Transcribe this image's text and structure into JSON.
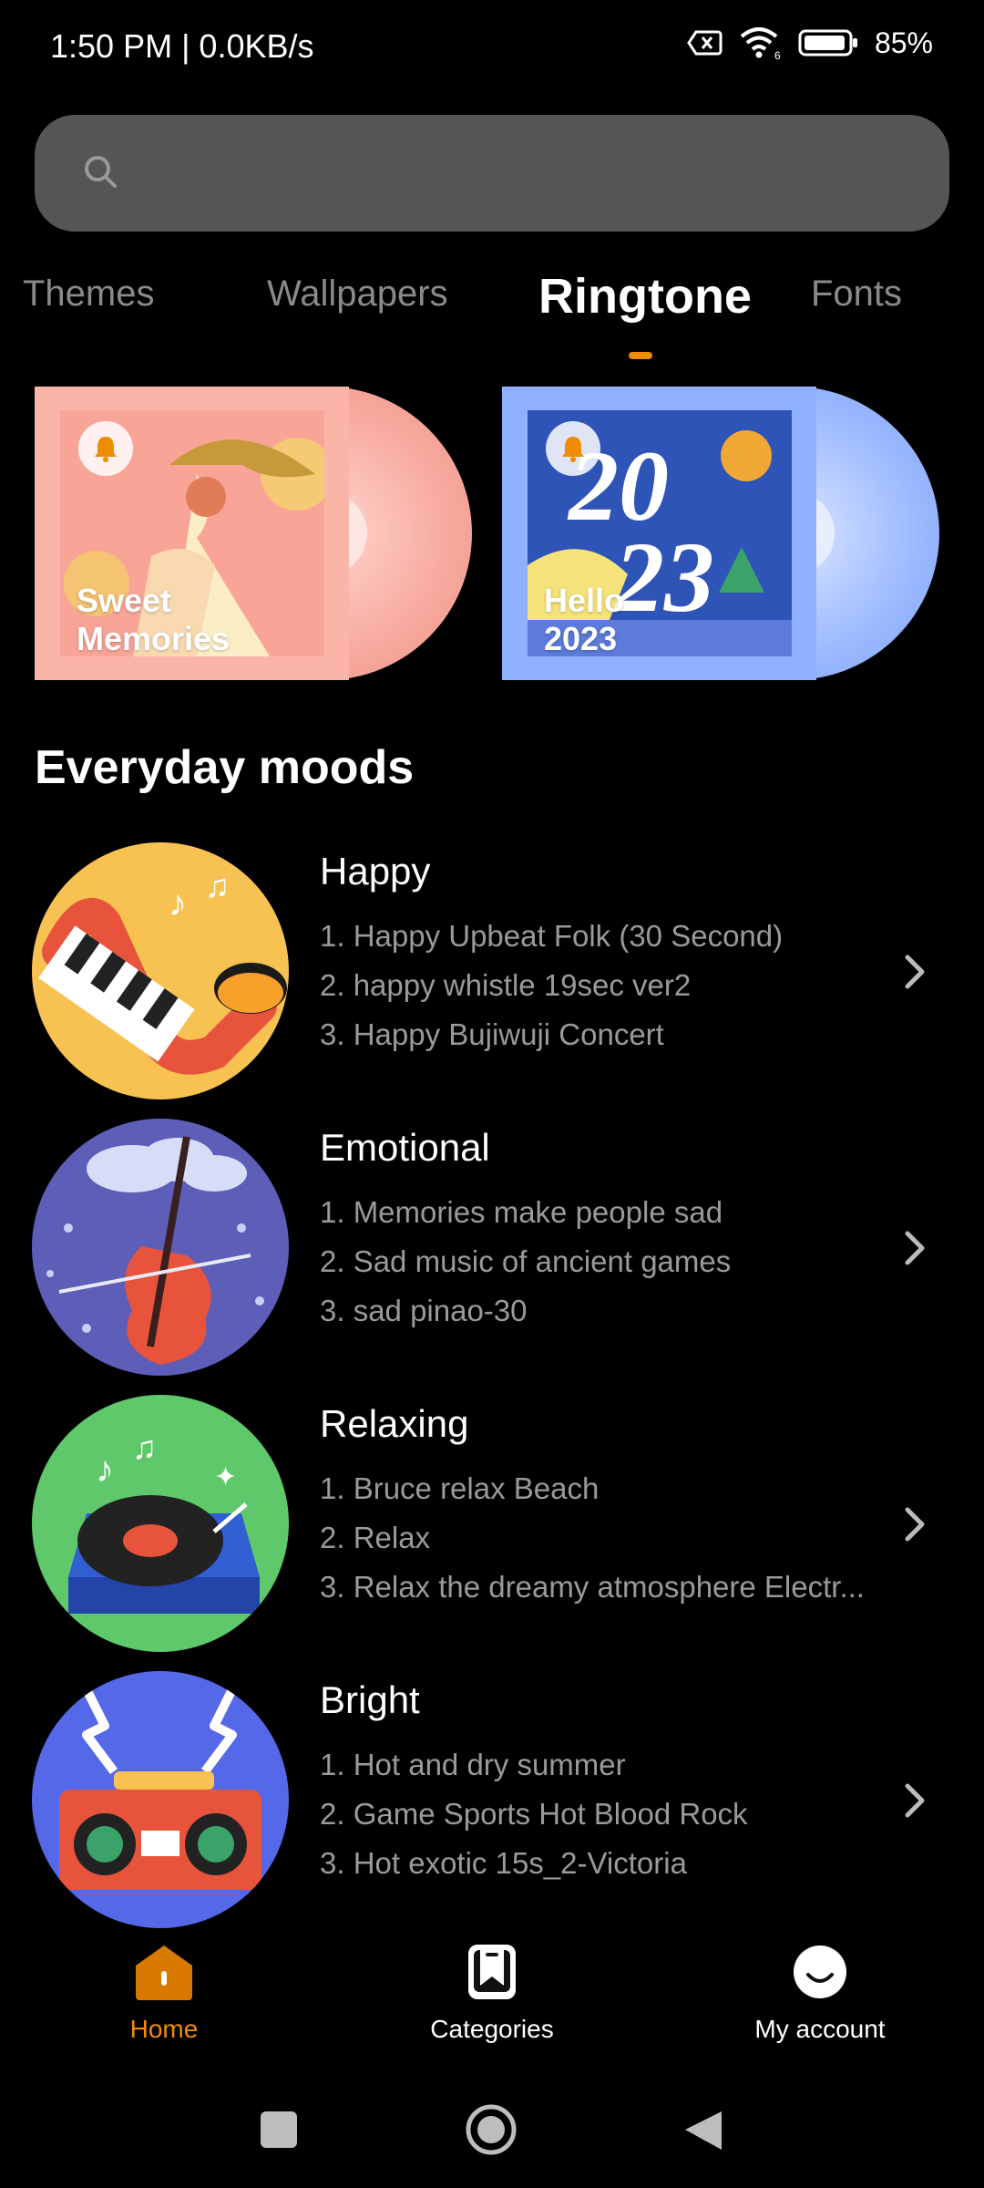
{
  "status": {
    "time": "1:50 PM | 0.0KB/s",
    "battery": "85%"
  },
  "search": {
    "placeholder": ""
  },
  "tabs": [
    {
      "label": "Themes",
      "active": false
    },
    {
      "label": "Wallpapers",
      "active": false
    },
    {
      "label": "Ringtone",
      "active": true
    },
    {
      "label": "Fonts",
      "active": false
    }
  ],
  "featured": [
    {
      "title_line1": "Sweet",
      "title_line2": "Memories",
      "accent": "#f7a99e"
    },
    {
      "title_line1": "Hello",
      "title_line2": "2023",
      "accent": "#8fb0ff"
    }
  ],
  "section": {
    "title": "Everyday moods"
  },
  "moods": [
    {
      "name": "Happy",
      "icon": "saxophone-art",
      "tracks": [
        "1. Happy Upbeat Folk (30 Second)",
        "2. happy whistle 19sec ver2",
        "3. Happy Bujiwuji Concert"
      ]
    },
    {
      "name": "Emotional",
      "icon": "cello-rain-art",
      "tracks": [
        "1. Memories make people sad",
        "2. Sad music of ancient games",
        "3. sad pinao-30"
      ]
    },
    {
      "name": "Relaxing",
      "icon": "turntable-art",
      "tracks": [
        "1. Bruce relax Beach",
        "2. Relax",
        "3. Relax the dreamy atmosphere Electr..."
      ]
    },
    {
      "name": "Bright",
      "icon": "boombox-art",
      "tracks": [
        "1. Hot and dry summer",
        "2. Game Sports Hot Blood Rock",
        "3. Hot exotic 15s_2-Victoria"
      ]
    }
  ],
  "bottom_nav": [
    {
      "label": "Home",
      "icon": "home-icon",
      "active": true
    },
    {
      "label": "Categories",
      "icon": "categories-icon",
      "active": false
    },
    {
      "label": "My account",
      "icon": "account-icon",
      "active": false
    }
  ],
  "colors": {
    "accent": "#f08c00",
    "search_bg": "#555555",
    "muted_text": "#9a9a9a"
  }
}
